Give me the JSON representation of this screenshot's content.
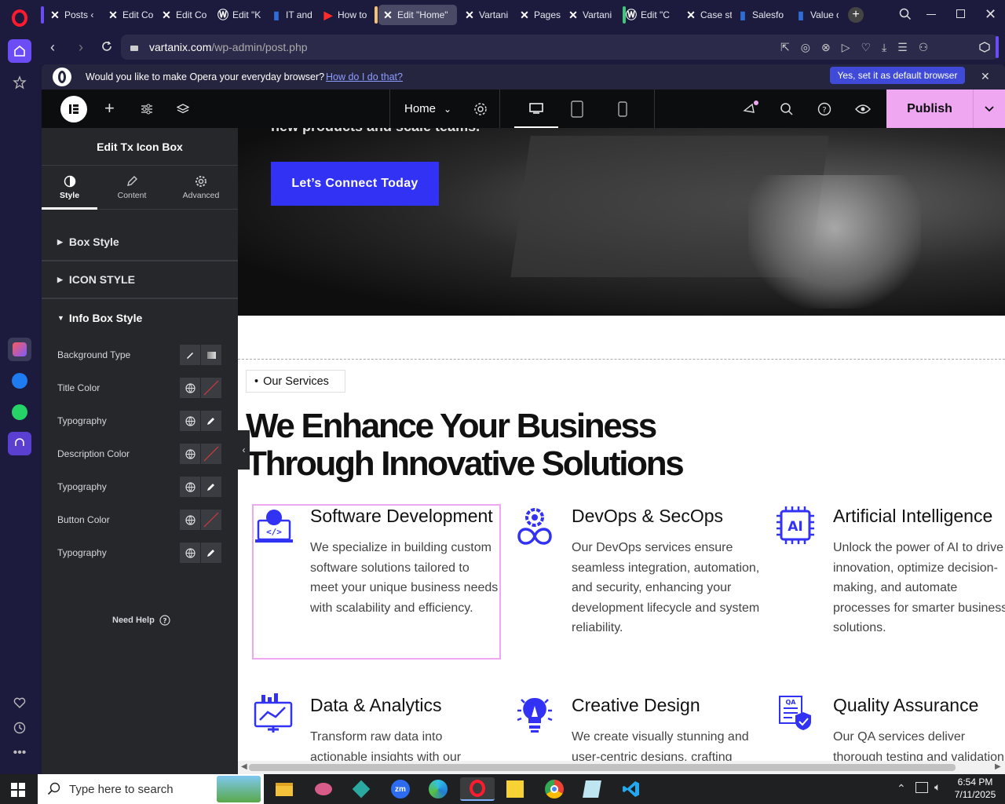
{
  "browser": {
    "tabs": [
      {
        "label": "Posts ‹",
        "favicon": "x",
        "active": false
      },
      {
        "label": "Edit Co",
        "favicon": "x",
        "active": false
      },
      {
        "label": "Edit Co",
        "favicon": "x",
        "active": false
      },
      {
        "label": "Edit \"K",
        "favicon": "wp",
        "active": false
      },
      {
        "label": "IT and",
        "favicon": "doc",
        "active": false
      },
      {
        "label": "How to",
        "favicon": "yt",
        "active": false
      },
      {
        "label": "Edit \"Home\"",
        "favicon": "x",
        "active": true
      },
      {
        "label": "Vartani",
        "favicon": "x",
        "active": false
      },
      {
        "label": "Pages ‹",
        "favicon": "x",
        "active": false
      },
      {
        "label": "Vartani",
        "favicon": "x",
        "active": false
      },
      {
        "label": "Edit \"C",
        "favicon": "wp",
        "active": false
      },
      {
        "label": "Case st",
        "favicon": "x",
        "active": false
      },
      {
        "label": "Salesfo",
        "favicon": "doc",
        "active": false
      },
      {
        "label": "Value c",
        "favicon": "doc",
        "active": false
      }
    ],
    "url_domain": "vartanix.com",
    "url_path": "/wp-admin/post.php",
    "infobar": {
      "message": "Would you like to make Opera your everyday browser?",
      "link": "How do I do that?",
      "button": "Yes, set it as default browser"
    }
  },
  "elementor": {
    "page_label": "Home",
    "publish_label": "Publish",
    "panel": {
      "title": "Edit Tx Icon Box",
      "tabs": [
        "Style",
        "Content",
        "Advanced"
      ],
      "sections": [
        "Box Style",
        "ICON STYLE",
        "Info Box Style"
      ],
      "controls": [
        {
          "label": "Background Type",
          "kind": "bg"
        },
        {
          "label": "Title Color",
          "kind": "color"
        },
        {
          "label": "Typography",
          "kind": "typo"
        },
        {
          "label": "Description Color",
          "kind": "color"
        },
        {
          "label": "Typography",
          "kind": "typo"
        },
        {
          "label": "Button Color",
          "kind": "color"
        },
        {
          "label": "Typography",
          "kind": "typo"
        }
      ],
      "need_help": "Need Help"
    }
  },
  "page": {
    "hero_partial_text": "new products and scale teams.",
    "cta_label": "Let’s Connect Today",
    "section_tag": "Our Services",
    "heading_line1": "We Enhance Your Business",
    "heading_line2": "Through Innovative Solutions",
    "services": [
      {
        "title": "Software Development",
        "desc": "We specialize in building custom software solutions tailored to meet your unique business needs with scalability and efficiency.",
        "icon": "software-dev-icon"
      },
      {
        "title": "DevOps & SecOps",
        "desc": "Our DevOps services ensure seamless integration, automation, and security, enhancing your development lifecycle and system reliability.",
        "icon": "devops-icon"
      },
      {
        "title": "Artificial Intelligence",
        "desc": "Unlock the power of AI to drive innovation, optimize decision-making, and automate processes for smarter business solutions.",
        "icon": "ai-chip-icon"
      },
      {
        "title": "Data & Analytics",
        "desc": "Transform raw data into actionable insights with our",
        "icon": "analytics-icon"
      },
      {
        "title": "Creative Design",
        "desc": "We create visually stunning and user-centric designs, crafting",
        "icon": "lightbulb-icon"
      },
      {
        "title": "Quality Assurance",
        "desc": "Our QA services deliver thorough testing and validation, ensuring",
        "icon": "qa-shield-icon"
      }
    ]
  },
  "taskbar": {
    "search_placeholder": "Type here to search",
    "time": "6:54 PM",
    "date": "7/11/2025"
  },
  "colors": {
    "accent_blue": "#3232f5",
    "publish_pink": "#f0a7f2",
    "opera_red": "#ff1b2d"
  }
}
